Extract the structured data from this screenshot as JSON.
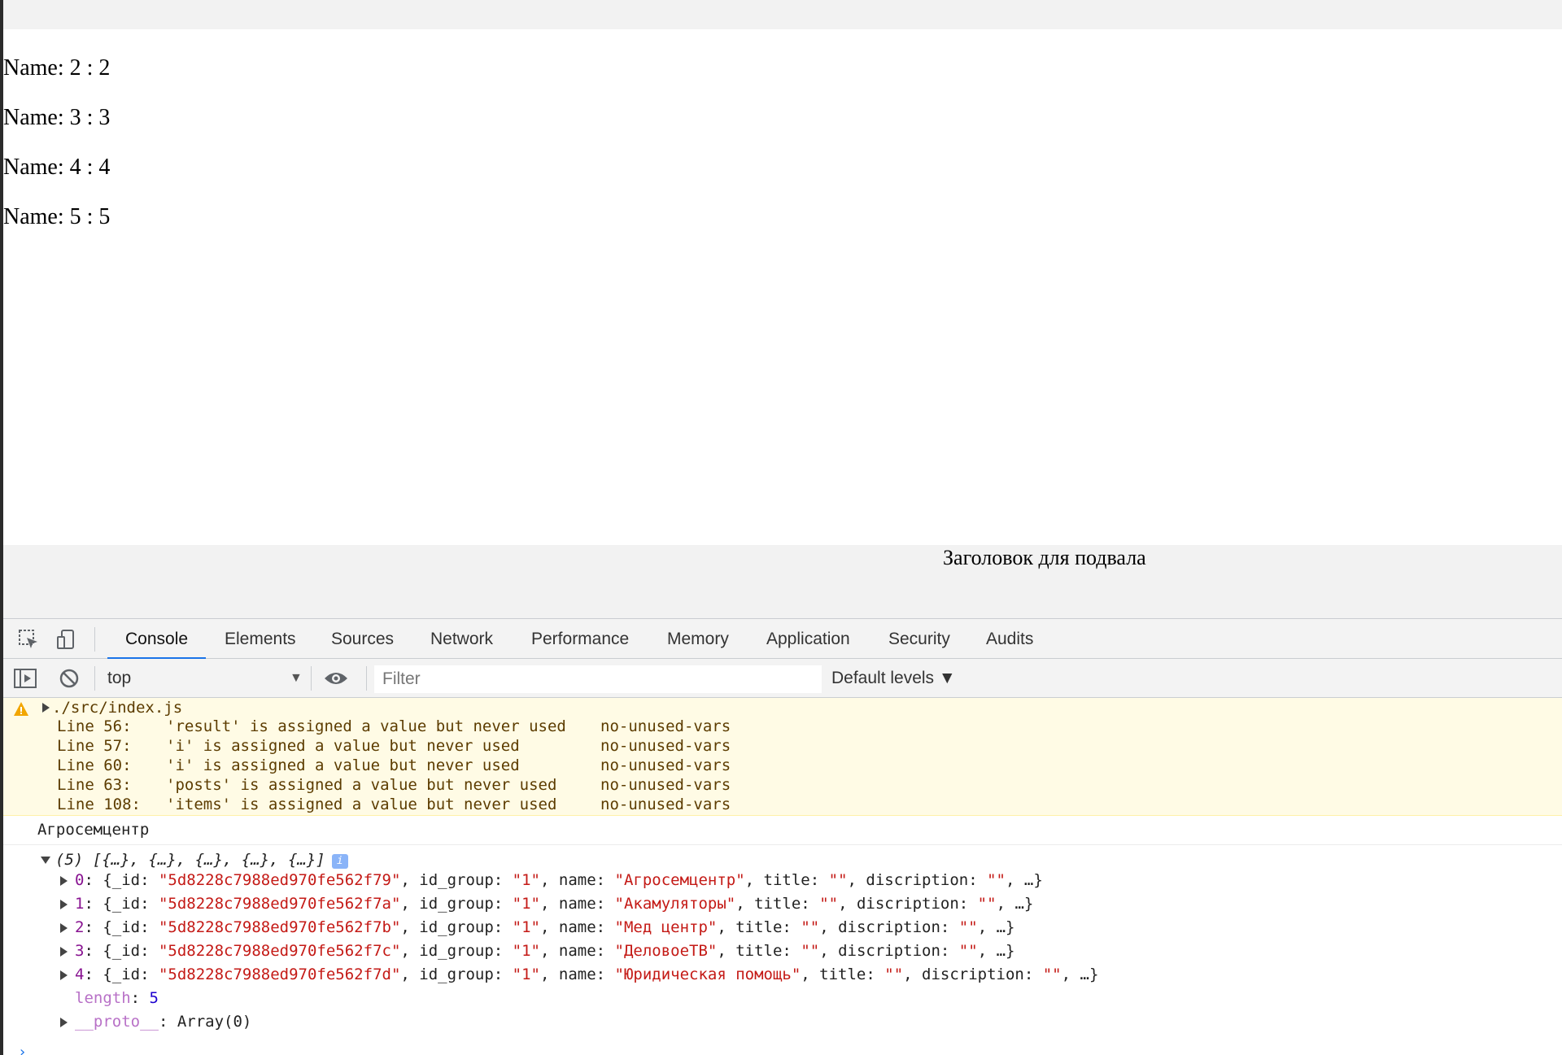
{
  "page": {
    "names": [
      "Name: 2 : 2",
      "Name: 3 : 3",
      "Name: 4 : 4",
      "Name: 5 : 5"
    ],
    "footer_title": "Заголовок для подвала"
  },
  "devtools": {
    "tabs": [
      "Console",
      "Elements",
      "Sources",
      "Network",
      "Performance",
      "Memory",
      "Application",
      "Security",
      "Audits"
    ],
    "active_tab": "Console",
    "context": "top",
    "filter_placeholder": "Filter",
    "levels_label": "Default levels ▼"
  },
  "console": {
    "warning": {
      "file": "./src/index.js",
      "lines": [
        {
          "num": "Line 56:",
          "msg": "'result' is assigned a value but never used",
          "rule": "no-unused-vars"
        },
        {
          "num": "Line 57:",
          "msg": "'i' is assigned a value but never used",
          "rule": "no-unused-vars"
        },
        {
          "num": "Line 60:",
          "msg": "'i' is assigned a value but never used",
          "rule": "no-unused-vars"
        },
        {
          "num": "Line 63:",
          "msg": "'posts' is assigned a value but never used",
          "rule": "no-unused-vars"
        },
        {
          "num": "Line 108:",
          "msg": "'items' is assigned a value but never used",
          "rule": "no-unused-vars"
        }
      ]
    },
    "log": "Агросемцентр",
    "array_summary": "(5) [{…}, {…}, {…}, {…}, {…}]",
    "items": [
      {
        "index": "0",
        "id": "\"5d8228c7988ed970fe562f79\"",
        "group": "\"1\"",
        "name": "\"Агросемцентр\""
      },
      {
        "index": "1",
        "id": "\"5d8228c7988ed970fe562f7a\"",
        "group": "\"1\"",
        "name": "\"Акамуляторы\""
      },
      {
        "index": "2",
        "id": "\"5d8228c7988ed970fe562f7b\"",
        "group": "\"1\"",
        "name": "\"Мед центр\""
      },
      {
        "index": "3",
        "id": "\"5d8228c7988ed970fe562f7c\"",
        "group": "\"1\"",
        "name": "\"ДеловоеТВ\""
      },
      {
        "index": "4",
        "id": "\"5d8228c7988ed970fe562f7d\"",
        "group": "\"1\"",
        "name": "\"Юридическая помощь\""
      }
    ],
    "length_label": "length",
    "length_value": "5",
    "proto_label": "__proto__",
    "proto_value": "Array(0)"
  }
}
